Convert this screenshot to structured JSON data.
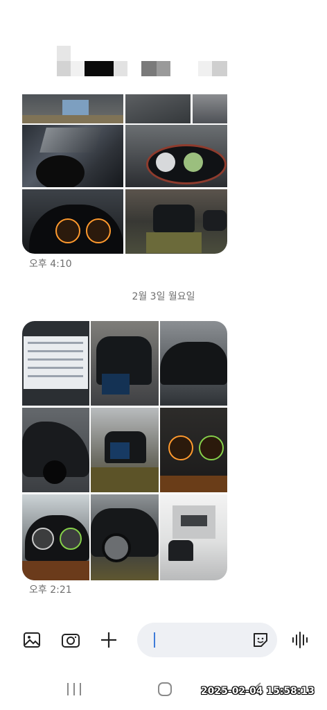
{
  "conversation": {
    "first_group_time": "오후 4:10",
    "date_divider": "2월 3일 월요일",
    "second_group_time": "오후 2:21"
  },
  "media_groups": [
    {
      "photos": [
        {
          "icon": "car-damage-photo"
        },
        {
          "icon": "car-damage-photo"
        },
        {
          "icon": "car-damage-photo"
        },
        {
          "icon": "car-damage-photo"
        },
        {
          "icon": "dashboard-photo"
        },
        {
          "icon": "dashboard-photo"
        },
        {
          "icon": "tow-truck-photo"
        }
      ]
    },
    {
      "photos": [
        {
          "icon": "document-photo"
        },
        {
          "icon": "car-photo"
        },
        {
          "icon": "car-photo"
        },
        {
          "icon": "car-photo"
        },
        {
          "icon": "tow-truck-photo"
        },
        {
          "icon": "dashboard-photo"
        },
        {
          "icon": "dashboard-photo"
        },
        {
          "icon": "car-photo"
        },
        {
          "icon": "tow-truck-photo"
        }
      ]
    }
  ],
  "composer": {
    "gallery_icon": "gallery-icon",
    "camera_icon": "camera-icon",
    "add_icon": "plus-icon",
    "emoji_icon": "emoji-sticker-icon",
    "voice_icon": "voice-icon"
  },
  "navigation": {
    "recent_icon": "recent-apps-icon",
    "home_icon": "home-icon",
    "back_icon": "back-icon"
  },
  "timestamp_overlay": "2025-02-04 15:58:13",
  "colors": {
    "accent": "#3d7bd9",
    "timestamp_text": "#6e6e6e",
    "input_background": "#eef0f4"
  }
}
